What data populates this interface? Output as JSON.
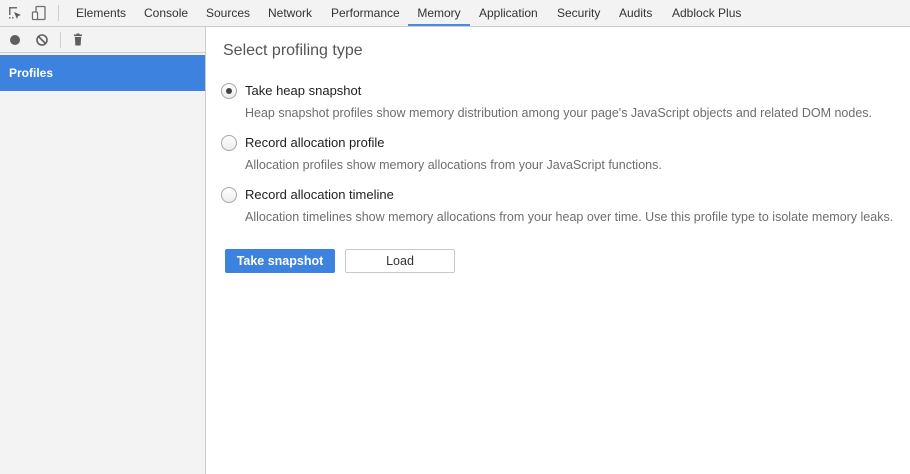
{
  "toolbar": {
    "icons": [
      "inspect-element-icon",
      "device-toggle-icon"
    ],
    "tabs": [
      {
        "label": "Elements",
        "selected": false
      },
      {
        "label": "Console",
        "selected": false
      },
      {
        "label": "Sources",
        "selected": false
      },
      {
        "label": "Network",
        "selected": false
      },
      {
        "label": "Performance",
        "selected": false
      },
      {
        "label": "Memory",
        "selected": true
      },
      {
        "label": "Application",
        "selected": false
      },
      {
        "label": "Security",
        "selected": false
      },
      {
        "label": "Audits",
        "selected": false
      },
      {
        "label": "Adblock Plus",
        "selected": false
      }
    ],
    "accent_color": "#4a8be5"
  },
  "sidebar": {
    "tool_icons": [
      "record-icon",
      "clear-icon",
      "trash-icon"
    ],
    "items": [
      {
        "label": "Profiles",
        "selected": true
      }
    ],
    "selected_color": "#3d82de"
  },
  "main": {
    "title": "Select profiling type",
    "options": [
      {
        "label": "Take heap snapshot",
        "description": "Heap snapshot profiles show memory distribution among your page's JavaScript objects and related DOM nodes.",
        "checked": true
      },
      {
        "label": "Record allocation profile",
        "description": "Allocation profiles show memory allocations from your JavaScript functions.",
        "checked": false
      },
      {
        "label": "Record allocation timeline",
        "description": "Allocation timelines show memory allocations from your heap over time. Use this profile type to isolate memory leaks.",
        "checked": false
      }
    ],
    "primary_button": "Take snapshot",
    "secondary_button": "Load"
  }
}
